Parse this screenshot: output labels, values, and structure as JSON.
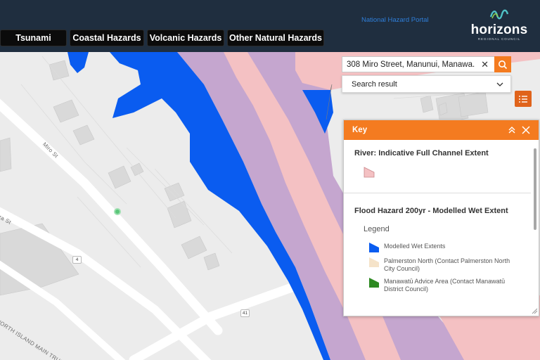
{
  "header": {
    "tabs": [
      {
        "label": "Tsunami"
      },
      {
        "label": "Coastal Hazards"
      },
      {
        "label": "Volcanic Hazards"
      },
      {
        "label": "Other Natural Hazards"
      }
    ],
    "portal_link": "National Hazard Portal",
    "logo": {
      "word": "horizons",
      "sub": "REGIONAL COUNCIL"
    }
  },
  "search": {
    "value": "308 Miro Street, Manunui, Manawa...",
    "result_label": "Search result"
  },
  "map": {
    "street_labels": [
      "Miro St",
      "ra St",
      "NORTH ISLAND MAIN TRUNK"
    ],
    "shields": [
      "4",
      "41"
    ],
    "colors": {
      "background": "#ececec",
      "road": "#ffffff",
      "building": "#d7d7d7",
      "flood_wet": "#0a5cf0",
      "channel": "#f4c1c3",
      "purple": "#c5a6cf"
    }
  },
  "key": {
    "title": "Key",
    "section1": {
      "title": "River: Indicative Full Channel Extent",
      "swatch_color": "#f4c1c3"
    },
    "section2": {
      "title": "Flood Hazard 200yr - Modelled Wet Extent",
      "legend_label": "Legend",
      "items": [
        {
          "label": "Modelled Wet Extents",
          "color": "#0a5cf0"
        },
        {
          "label": "Palmerston North (Contact Palmerston North City Council)",
          "color": "#f5e3c9"
        },
        {
          "label": "Manawatū Advice Area (Contact Manawatū District Council)",
          "color": "#2e8a22"
        }
      ]
    }
  },
  "colors": {
    "header_bg": "#1f2e3f",
    "accent_orange": "#f47b20",
    "tab_bg": "#0b0b0b"
  }
}
